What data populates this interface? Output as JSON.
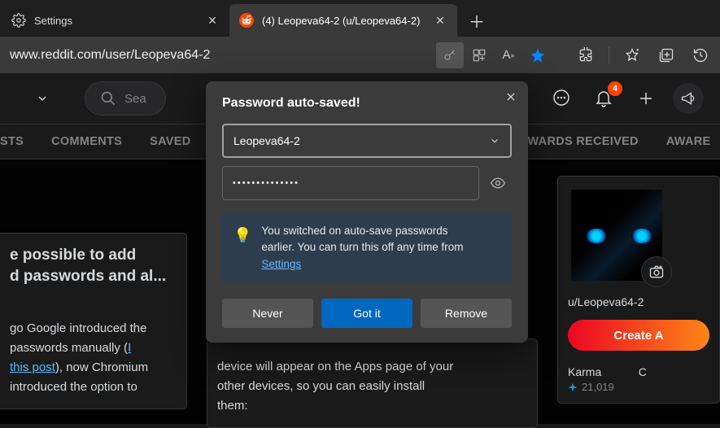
{
  "tabs": {
    "inactive": {
      "label": "Settings"
    },
    "active": {
      "label": "(4) Leopeva64-2 (u/Leopeva64-2)"
    }
  },
  "address_bar": {
    "url": "www.reddit.com/user/Leopeva64-2"
  },
  "reddit_header": {
    "search_placeholder": "Sea",
    "notif_count": "4"
  },
  "profile_nav": {
    "t0": "STS",
    "t1": "COMMENTS",
    "t2": "SAVED",
    "t3": "WARDS RECEIVED",
    "t4": "AWARE"
  },
  "left_post": {
    "title_l1": "e possible to add",
    "title_l2": "d passwords and al...",
    "body_l1": "go Google introduced the",
    "body_l2_a": "passwords manually (",
    "body_l2_link1": "I",
    "body_l3_link": "this post",
    "body_l3_b": "), now Chromium",
    "body_l4": "introduced the option to"
  },
  "mid_post": {
    "l1": "device will appear on the Apps page of your",
    "l2": "other devices, so you can easily install",
    "l3": "them:"
  },
  "profile_card": {
    "username": "u/Leopeva64-2",
    "create_label": "Create A",
    "karma_label": "Karma",
    "karma_value": "21,019",
    "cake_label": "C"
  },
  "popup": {
    "title": "Password auto-saved!",
    "username": "Leopeva64-2",
    "password_mask": "••••••••••••••",
    "info_l1": "You switched on auto-save passwords",
    "info_l2": "earlier. You can turn this off any time from ",
    "settings_link": "Settings",
    "never": "Never",
    "gotit": "Got it",
    "remove": "Remove"
  }
}
